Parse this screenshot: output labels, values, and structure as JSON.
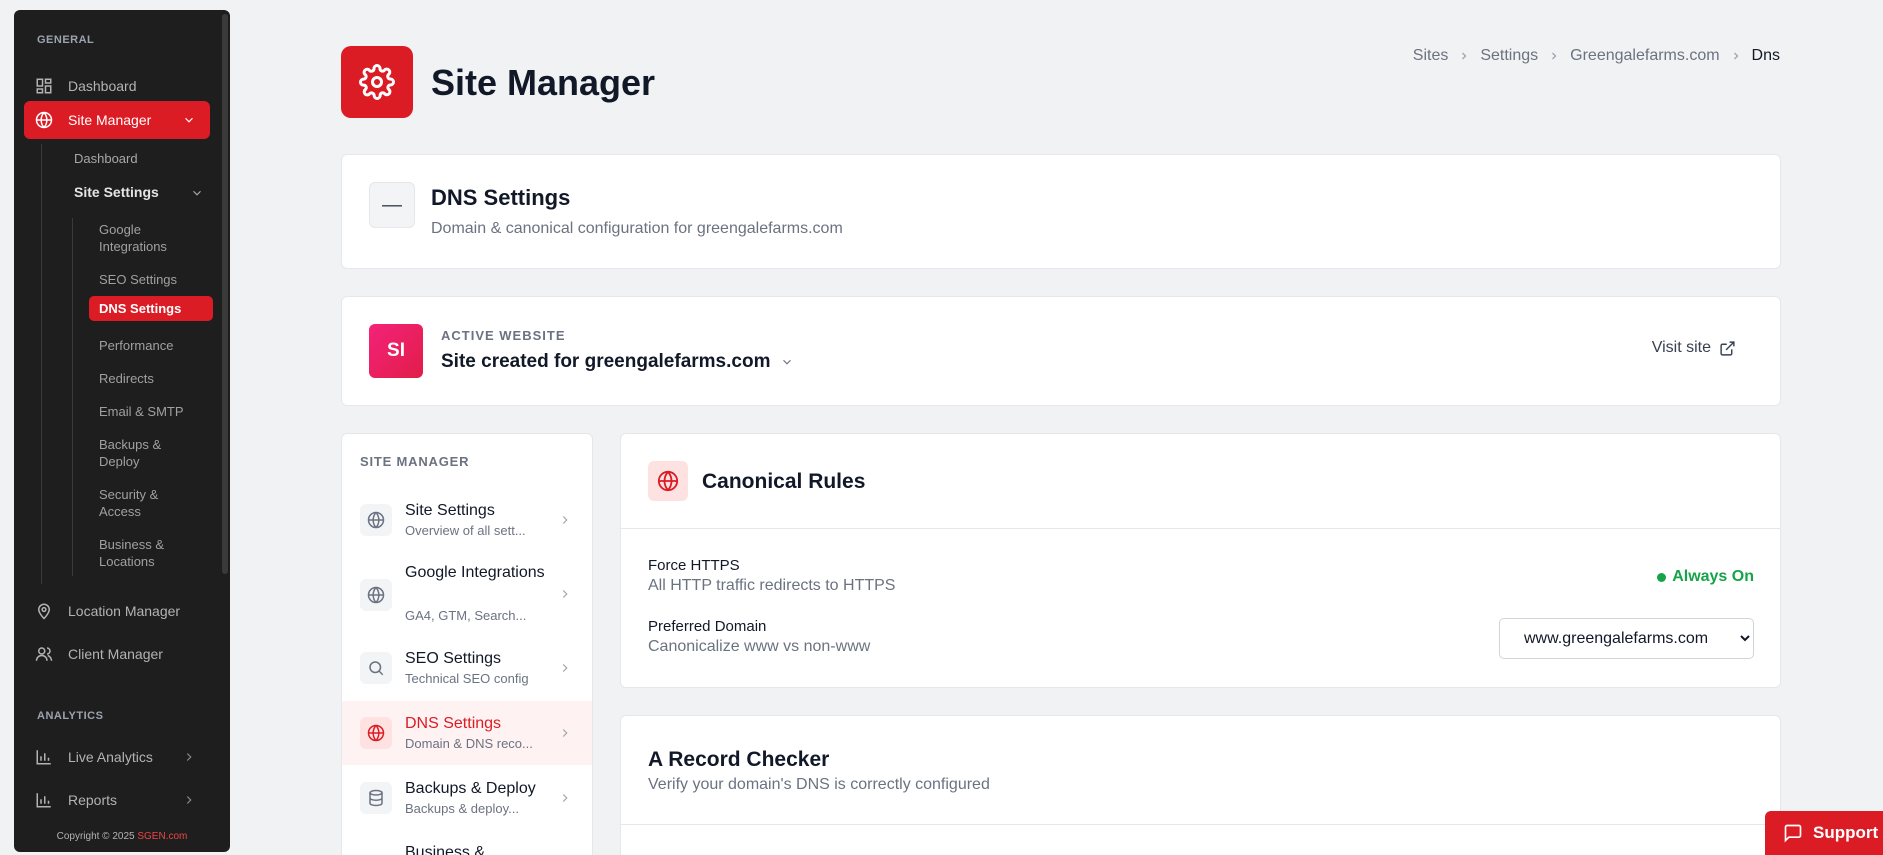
{
  "sidebar": {
    "section_general": "GENERAL",
    "dashboard": "Dashboard",
    "site_manager": "Site Manager",
    "sub_dashboard": "Dashboard",
    "site_settings": "Site Settings",
    "leaves": [
      "Google Integrations",
      "SEO Settings",
      "DNS Settings",
      "Performance",
      "Redirects",
      "Email & SMTP",
      "Backups & Deploy",
      "Security & Access",
      "Business & Locations"
    ],
    "location_manager": "Location Manager",
    "client_manager": "Client Manager",
    "section_analytics": "ANALYTICS",
    "live_analytics": "Live Analytics",
    "reports": "Reports",
    "copyright": "Copyright © 2025 ",
    "brand": "SGEN.com"
  },
  "header": {
    "title": "Site Manager",
    "breadcrumb": [
      "Sites",
      "Settings",
      "Greengalefarms.com",
      "Dns"
    ]
  },
  "dns_card": {
    "collapse": "—",
    "title": "DNS Settings",
    "subtitle": "Domain & canonical configuration for greengalefarms.com"
  },
  "active_site": {
    "avatar": "SI",
    "label": "ACTIVE WEBSITE",
    "name": "Site created for greengalefarms.com",
    "visit": "Visit site"
  },
  "site_nav": {
    "heading": "SITE MANAGER",
    "items": [
      {
        "title": "Site Settings",
        "sub": "Overview of all sett..."
      },
      {
        "title": "Google Integrations",
        "sub": "GA4, GTM, Search..."
      },
      {
        "title": "SEO Settings",
        "sub": "Technical SEO config"
      },
      {
        "title": "DNS Settings",
        "sub": "Domain & DNS reco..."
      },
      {
        "title": "Backups & Deploy",
        "sub": "Backups & deploy..."
      },
      {
        "title": "Business &",
        "sub": ""
      }
    ]
  },
  "canonical": {
    "title": "Canonical Rules",
    "https_label": "Force HTTPS",
    "https_sub": "All HTTP traffic redirects to HTTPS",
    "https_status": "Always On",
    "domain_label": "Preferred Domain",
    "domain_sub": "Canonicalize www vs non-www",
    "domain_value": "www.greengalefarms.com"
  },
  "a_record": {
    "title": "A Record Checker",
    "subtitle": "Verify your domain's DNS is correctly configured"
  },
  "support": "Support",
  "colors": {
    "accent": "#dc1c24",
    "sidebar_bg": "#1e1e1e",
    "success": "#16a34a"
  }
}
